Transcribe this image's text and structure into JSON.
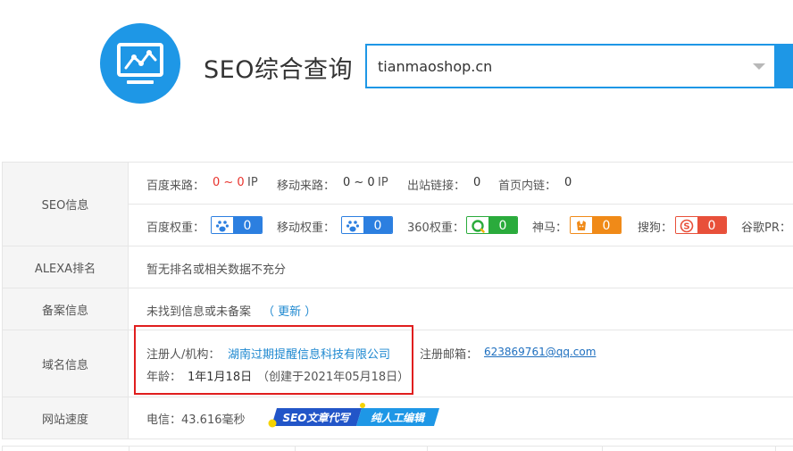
{
  "header": {
    "title": "SEO综合查询",
    "search_value": "tianmaoshop.cn",
    "logo_icon": "chart-monitor-icon",
    "accent_color": "#1e97e6"
  },
  "rows": {
    "seo": {
      "label": "SEO信息",
      "line1": {
        "baidu_traffic_label": "百度来路：",
        "baidu_traffic_value": "0 ~ 0",
        "baidu_traffic_unit": "IP",
        "mobile_traffic_label": "移动来路：",
        "mobile_traffic_value": "0 ~ 0",
        "mobile_traffic_unit": "IP",
        "outbound_label": "出站链接：",
        "outbound_value": "0",
        "homepage_links_label": "首页内链：",
        "homepage_links_value": "0"
      },
      "line2": {
        "baidu_weight_label": "百度权重：",
        "baidu_weight_value": "0",
        "mobile_weight_label": "移动权重：",
        "mobile_weight_value": "0",
        "w360_label": "360权重：",
        "w360_value": "0",
        "shenma_label": "神马：",
        "shenma_value": "0",
        "sogou_label": "搜狗：",
        "sogou_value": "0",
        "google_pr_label": "谷歌PR："
      }
    },
    "alexa": {
      "label": "ALEXA排名",
      "text": "暂无排名或相关数据不充分"
    },
    "beian": {
      "label": "备案信息",
      "text": "未找到信息或未备案",
      "update_link": "（ 更新 ）"
    },
    "domain": {
      "label": "域名信息",
      "registrant_label": "注册人/机构：",
      "registrant_value": "湖南过期提醒信息科技有限公司",
      "email_label": "注册邮箱：",
      "email_value": "623869761@qq.com",
      "age_label": "年龄：",
      "age_value": "1年1月18日",
      "created": "（创建于2021年05月18日）"
    },
    "speed": {
      "label": "网站速度",
      "text": "电信：43.616毫秒",
      "banner_left": "SEO文章代写",
      "banner_right": "纯人工编辑"
    }
  }
}
